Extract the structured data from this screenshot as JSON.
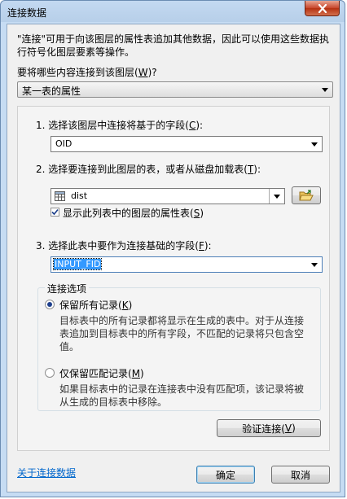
{
  "window": {
    "title": "连接数据",
    "close_label": "关闭"
  },
  "description": "\"连接\"可用于向该图层的属性表追加其他数据，因此可以使用这些数据执行符号化图层要素等操作。",
  "join_what": {
    "label_pre": "要将哪些内容连接到该图层(",
    "label_key": "W",
    "label_post": ")?",
    "value": "某一表的属性"
  },
  "step1": {
    "label_pre": "1.  选择该图层中连接将基于的字段(",
    "label_key": "C",
    "label_post": "):",
    "value": "OID"
  },
  "step2": {
    "label_pre": "2.  选择要连接到此图层的表，或者从磁盘加载表(",
    "label_key": "T",
    "label_post": "):",
    "value": "dist",
    "show_layers_label_pre": "显示此列表中的图层的属性表(",
    "show_layers_key": "S",
    "show_layers_label_post": ")",
    "show_layers_checked": true
  },
  "step3": {
    "label_pre": "3.  选择此表中要作为连接基础的字段(",
    "label_key": "F",
    "label_post": "):",
    "value": "INPUT_FID"
  },
  "join_options": {
    "legend": "连接选项",
    "keep_all_label_pre": "保留所有记录(",
    "keep_all_key": "K",
    "keep_all_label_post": ")",
    "keep_all_desc": "目标表中的所有记录都将显示在生成的表中。对于从连接表追加到目标表中的所有字段，不匹配的记录将只包含空值。",
    "keep_match_label_pre": "仅保留匹配记录(",
    "keep_match_key": "M",
    "keep_match_label_post": ")",
    "keep_match_desc": "如果目标表中的记录在连接表中没有匹配项，该记录将被从生成的目标表中移除。",
    "selected": "keep_all"
  },
  "validate": {
    "label_pre": "验证连接(",
    "label_key": "V",
    "label_post": ")"
  },
  "footer": {
    "about_link": "关于连接数据",
    "ok": "确定",
    "cancel": "取消"
  }
}
